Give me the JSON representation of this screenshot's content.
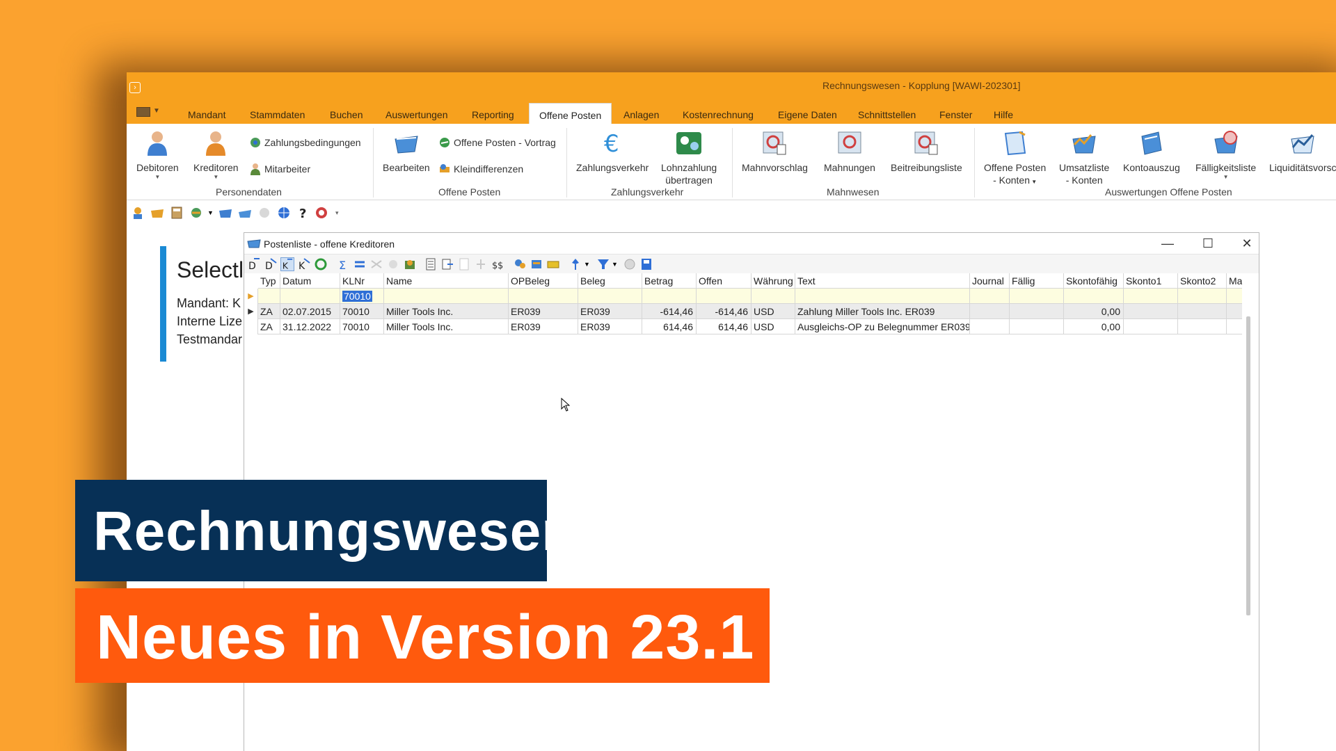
{
  "window": {
    "title": "Rechnungswesen - Kopplung [WAWI-202301]"
  },
  "menu": {
    "items": [
      "Mandant",
      "Stammdaten",
      "Buchen",
      "Auswertungen",
      "Reporting",
      "Offene Posten",
      "Anlagen",
      "Kostenrechnung",
      "Eigene Daten",
      "Schnittstellen",
      "Fenster",
      "Hilfe"
    ],
    "active": "Offene Posten"
  },
  "ribbon": {
    "personendaten": {
      "label": "Personendaten",
      "debitoren": "Debitoren",
      "kreditoren": "Kreditoren",
      "zahlungsbedingungen": "Zahlungsbedingungen",
      "mitarbeiter": "Mitarbeiter"
    },
    "offene_posten": {
      "label": "Offene Posten",
      "bearbeiten": "Bearbeiten",
      "vortrag": "Offene Posten - Vortrag",
      "kleindifferenzen": "Kleindifferenzen"
    },
    "zahlungsverkehr": {
      "label": "Zahlungsverkehr",
      "zahlungsverkehr": "Zahlungsverkehr",
      "lohnzahlung_1": "Lohnzahlung",
      "lohnzahlung_2": "übertragen"
    },
    "mahnwesen": {
      "label": "Mahnwesen",
      "mahnvorschlag": "Mahnvorschlag",
      "mahnungen": "Mahnungen",
      "beitreibungsliste": "Beitreibungsliste"
    },
    "auswertungen": {
      "label": "Auswertungen Offene Posten",
      "op_konten_1": "Offene Posten",
      "op_konten_2": "- Konten",
      "umsatzliste_1": "Umsatzliste",
      "umsatzliste_2": "- Konten",
      "kontoauszug": "Kontoauszug",
      "faelligkeitsliste": "Fälligkeitsliste",
      "liquiditaet": "Liquiditätsvorsc"
    }
  },
  "content": {
    "title": "Selectl",
    "line1": "Mandant: K",
    "line2": "Interne Lize",
    "line3": "Testmandar"
  },
  "child_window": {
    "title": "Postenliste - offene Kreditoren",
    "minimize": "—",
    "maximize": "☐",
    "close": "✕"
  },
  "grid": {
    "columns": [
      "Typ",
      "Datum",
      "KLNr",
      "Name",
      "OPBeleg",
      "Beleg",
      "Betrag",
      "Offen",
      "Währung",
      "Text",
      "Journal",
      "Fällig",
      "Skontofähig",
      "Skonto1",
      "Skonto2",
      "Mal"
    ],
    "filter_value": "70010",
    "rows": [
      {
        "typ": "ZA",
        "datum": "02.07.2015",
        "klnr": "70010",
        "name": "Miller Tools Inc.",
        "opbeleg": "ER039",
        "beleg": "ER039",
        "betrag": "-614,46",
        "offen": "-614,46",
        "waehrung": "USD",
        "text": "Zahlung Miller Tools Inc. ER039",
        "skontofaehig": "0,00"
      },
      {
        "typ": "ZA",
        "datum": "31.12.2022",
        "klnr": "70010",
        "name": "Miller Tools Inc.",
        "opbeleg": "ER039",
        "beleg": "ER039",
        "betrag": "614,46",
        "offen": "614,46",
        "waehrung": "USD",
        "text": "Ausgleichs-OP zu Belegnummer ER039",
        "skontofaehig": "0,00"
      }
    ]
  },
  "banner": {
    "line1": "Rechnungswesen",
    "line2": "Neues in Version 23.1"
  },
  "colors": {
    "background": "#fba22f",
    "titlebar": "#f7a11e",
    "banner_blue": "#073056",
    "banner_orange": "#ff5a0d",
    "accent_bar": "#1a8ad4"
  }
}
